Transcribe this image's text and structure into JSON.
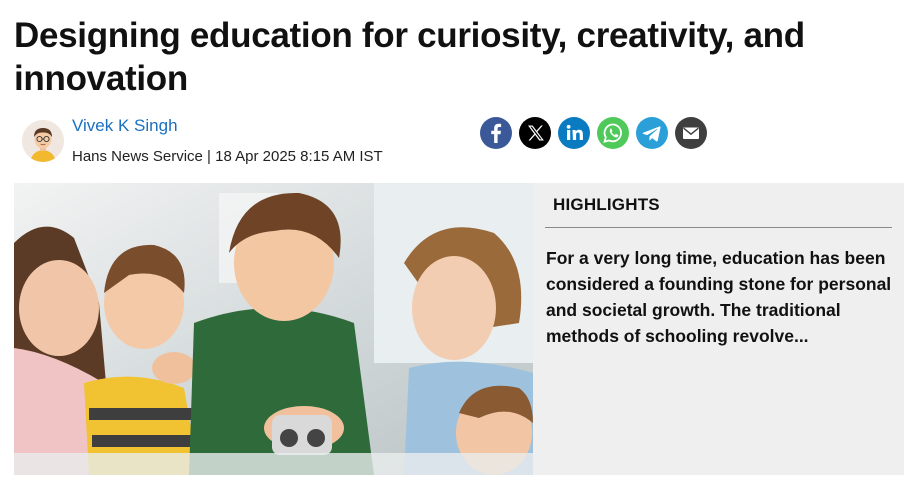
{
  "article": {
    "headline": "Designing education for curiosity, creativity, and innovation"
  },
  "author": {
    "name": "Vivek K Singh",
    "byline": "Hans News Service | 18 Apr 2025 8:15 AM IST",
    "avatar_icon": "author-avatar-illustration"
  },
  "share": {
    "buttons": [
      {
        "icon": "facebook-icon",
        "color": "#3b5998"
      },
      {
        "icon": "x-icon",
        "color": "#000000"
      },
      {
        "icon": "linkedin-icon",
        "color": "#0a7bc1"
      },
      {
        "icon": "whatsapp-icon",
        "color": "#4fc95a"
      },
      {
        "icon": "telegram-icon",
        "color": "#2a9fd8"
      },
      {
        "icon": "email-icon",
        "color": "#3f3f3f"
      }
    ]
  },
  "hero_image": {
    "icon": "children-science-class-photo"
  },
  "highlights": {
    "title": "HIGHLIGHTS",
    "text": "For a very long time, education has been considered a founding stone for personal and societal growth. The traditional methods of schooling revolve..."
  }
}
